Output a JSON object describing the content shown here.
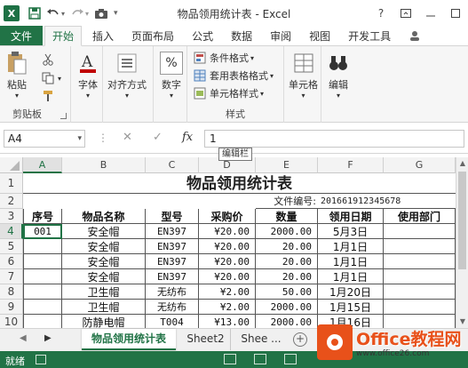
{
  "window": {
    "title": "物品领用统计表 - Excel",
    "help": "?"
  },
  "tabs": [
    {
      "label": "文件"
    },
    {
      "label": "开始"
    },
    {
      "label": "插入"
    },
    {
      "label": "页面布局"
    },
    {
      "label": "公式"
    },
    {
      "label": "数据"
    },
    {
      "label": "审阅"
    },
    {
      "label": "视图"
    },
    {
      "label": "开发工具"
    }
  ],
  "ribbon": {
    "paste": "粘贴",
    "clipboard_group": "剪贴板",
    "font": "字体",
    "alignment": "对齐方式",
    "number": "数字",
    "number_symbol": "%",
    "conditional_format": "条件格式",
    "table_format": "套用表格格式",
    "cell_style": "单元格样式",
    "styles_group": "样式",
    "cells": "单元格",
    "editing": "编辑",
    "dropdown": "▾"
  },
  "formula_bar": {
    "name_box": "A4",
    "value": "1",
    "tooltip": "编辑栏",
    "fx": "fx",
    "cancel": "✕",
    "enter": "✓",
    "dots": "⋮"
  },
  "columns": [
    "A",
    "B",
    "C",
    "D",
    "E",
    "F",
    "G"
  ],
  "rows": [
    "1",
    "2",
    "3",
    "4",
    "5",
    "6",
    "7",
    "8",
    "9",
    "10"
  ],
  "sheet": {
    "title": "物品领用统计表",
    "doc_no_label": "文件编号:",
    "doc_no": "201661912345678",
    "headers": [
      "序号",
      "物品名称",
      "型号",
      "采购价",
      "数量",
      "领用日期",
      "使用部门"
    ],
    "data": [
      [
        "001",
        "安全帽",
        "EN397",
        "¥20.00",
        "2000.00",
        "5月3日",
        ""
      ],
      [
        "",
        "安全帽",
        "EN397",
        "¥20.00",
        "20.00",
        "1月1日",
        ""
      ],
      [
        "",
        "安全帽",
        "EN397",
        "¥20.00",
        "20.00",
        "1月1日",
        ""
      ],
      [
        "",
        "安全帽",
        "EN397",
        "¥20.00",
        "20.00",
        "1月1日",
        ""
      ],
      [
        "",
        "卫生帽",
        "无纺布",
        "¥2.00",
        "50.00",
        "1月20日",
        ""
      ],
      [
        "",
        "卫生帽",
        "无纺布",
        "¥2.00",
        "2000.00",
        "1月15日",
        ""
      ],
      [
        "",
        "防静电帽",
        "T004",
        "¥13.00",
        "2000.00",
        "1月16日",
        ""
      ]
    ]
  },
  "sheet_tabs": [
    "物品领用统计表",
    "Sheet2",
    "Shee ..."
  ],
  "add_sheet": "+",
  "status": {
    "ready": "就绪"
  },
  "watermark": {
    "text": "Office教程网",
    "url": "www.office26.com"
  },
  "colors": {
    "accent": "#217346",
    "watermark": "#e8511a"
  }
}
